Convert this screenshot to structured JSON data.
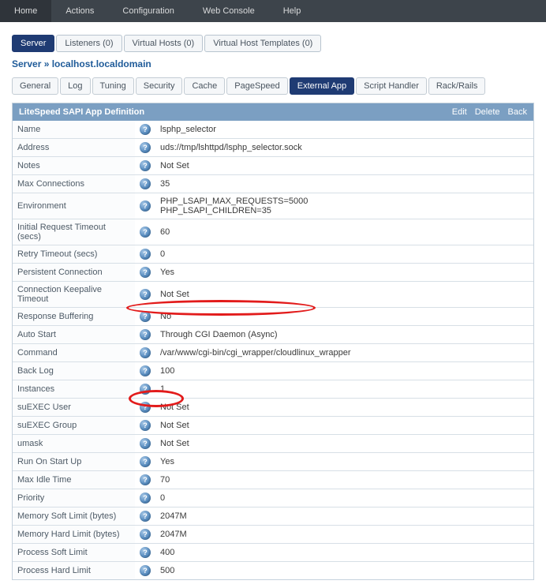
{
  "topnav": [
    "Home",
    "Actions",
    "Configuration",
    "Web Console",
    "Help"
  ],
  "tabs1": [
    {
      "label": "Server",
      "active": true
    },
    {
      "label": "Listeners (0)",
      "active": false
    },
    {
      "label": "Virtual Hosts (0)",
      "active": false
    },
    {
      "label": "Virtual Host Templates (0)",
      "active": false
    }
  ],
  "breadcrumb": "Server » localhost.localdomain",
  "tabs2": [
    {
      "label": "General",
      "active": false
    },
    {
      "label": "Log",
      "active": false
    },
    {
      "label": "Tuning",
      "active": false
    },
    {
      "label": "Security",
      "active": false
    },
    {
      "label": "Cache",
      "active": false
    },
    {
      "label": "PageSpeed",
      "active": false
    },
    {
      "label": "External App",
      "active": true
    },
    {
      "label": "Script Handler",
      "active": false
    },
    {
      "label": "Rack/Rails",
      "active": false
    }
  ],
  "panel": {
    "title": "LiteSpeed SAPI App Definition",
    "actions": {
      "edit": "Edit",
      "delete": "Delete",
      "back": "Back"
    }
  },
  "rows": [
    {
      "label": "Name",
      "value": "lsphp_selector"
    },
    {
      "label": "Address",
      "value": "uds://tmp/lshttpd/lsphp_selector.sock"
    },
    {
      "label": "Notes",
      "value": "Not Set",
      "notset": true
    },
    {
      "label": "Max Connections",
      "value": "35"
    },
    {
      "label": "Environment",
      "value": "PHP_LSAPI_MAX_REQUESTS=5000\nPHP_LSAPI_CHILDREN=35"
    },
    {
      "label": "Initial Request Timeout (secs)",
      "value": "60"
    },
    {
      "label": "Retry Timeout (secs)",
      "value": "0"
    },
    {
      "label": "Persistent Connection",
      "value": "Yes"
    },
    {
      "label": "Connection Keepalive Timeout",
      "value": "Not Set",
      "notset": true
    },
    {
      "label": "Response Buffering",
      "value": "No"
    },
    {
      "label": "Auto Start",
      "value": "Through CGI Daemon (Async)"
    },
    {
      "label": "Command",
      "value": "/var/www/cgi-bin/cgi_wrapper/cloudlinux_wrapper"
    },
    {
      "label": "Back Log",
      "value": "100"
    },
    {
      "label": "Instances",
      "value": "1"
    },
    {
      "label": "suEXEC User",
      "value": "Not Set",
      "notset": true
    },
    {
      "label": "suEXEC Group",
      "value": "Not Set",
      "notset": true
    },
    {
      "label": "umask",
      "value": "Not Set",
      "notset": true
    },
    {
      "label": "Run On Start Up",
      "value": "Yes"
    },
    {
      "label": "Max Idle Time",
      "value": "70"
    },
    {
      "label": "Priority",
      "value": "0"
    },
    {
      "label": "Memory Soft Limit (bytes)",
      "value": "2047M"
    },
    {
      "label": "Memory Hard Limit (bytes)",
      "value": "2047M"
    },
    {
      "label": "Process Soft Limit",
      "value": "400"
    },
    {
      "label": "Process Hard Limit",
      "value": "500"
    }
  ]
}
